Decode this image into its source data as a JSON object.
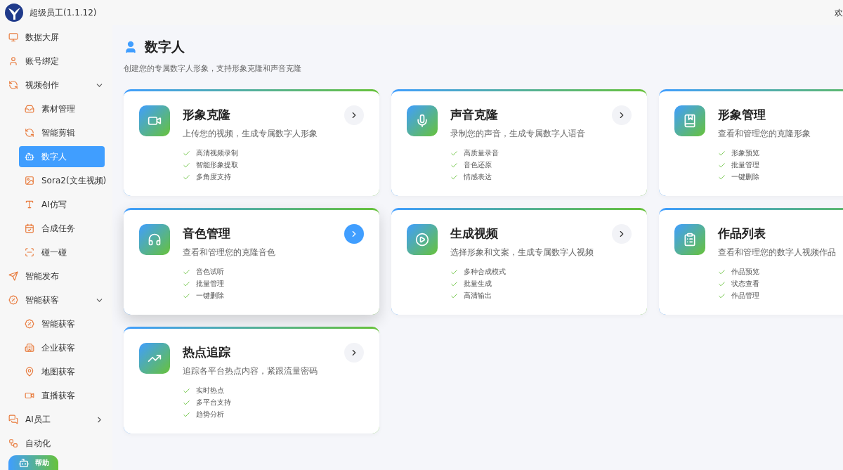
{
  "app": {
    "title": "超级员工(1.1.12)",
    "greeting": "欢"
  },
  "sidebar": {
    "items": [
      {
        "label": "数据大屏",
        "selected": false
      },
      {
        "label": "账号绑定",
        "selected": false
      },
      {
        "label": "视频创作",
        "selected": false,
        "expanded": true,
        "children": [
          {
            "label": "素材管理",
            "selected": false
          },
          {
            "label": "智能剪辑",
            "selected": false
          },
          {
            "label": "数字人",
            "selected": true
          },
          {
            "label": "Sora2(文生视频)",
            "selected": false
          },
          {
            "label": "AI仿写",
            "selected": false
          },
          {
            "label": "合成任务",
            "selected": false
          },
          {
            "label": "碰一碰",
            "selected": false
          }
        ]
      },
      {
        "label": "智能发布",
        "selected": false
      },
      {
        "label": "智能获客",
        "selected": false,
        "expanded": true,
        "children": [
          {
            "label": "智能获客",
            "selected": false
          },
          {
            "label": "企业获客",
            "selected": false
          },
          {
            "label": "地图获客",
            "selected": false
          },
          {
            "label": "直播获客",
            "selected": false
          }
        ]
      },
      {
        "label": "AI员工",
        "selected": false,
        "expanded": false
      },
      {
        "label": "自动化",
        "selected": false
      }
    ]
  },
  "help_button": {
    "label": "帮助"
  },
  "page": {
    "title": "数字人",
    "subtitle": "创建您的专属数字人形象，支持形象克隆和声音克隆"
  },
  "cards": [
    {
      "title": "形象克隆",
      "description": "上传您的视频，生成专属数字人形象",
      "features": [
        "高清视频录制",
        "智能形象提取",
        "多角度支持"
      ],
      "highlighted": false
    },
    {
      "title": "声音克隆",
      "description": "录制您的声音，生成专属数字人语音",
      "features": [
        "高质量录音",
        "音色还原",
        "情感表达"
      ],
      "highlighted": false
    },
    {
      "title": "形象管理",
      "description": "查看和管理您的克隆形象",
      "features": [
        "形象预览",
        "批量管理",
        "一键删除"
      ],
      "highlighted": false
    },
    {
      "title": "音色管理",
      "description": "查看和管理您的克隆音色",
      "features": [
        "音色试听",
        "批量管理",
        "一键删除"
      ],
      "highlighted": true
    },
    {
      "title": "生成视频",
      "description": "选择形象和文案，生成专属数字人视频",
      "features": [
        "多种合成模式",
        "批量生成",
        "高清输出"
      ],
      "highlighted": false
    },
    {
      "title": "作品列表",
      "description": "查看和管理您的数字人视频作品",
      "features": [
        "作品预览",
        "状态查看",
        "作品管理"
      ],
      "highlighted": false
    },
    {
      "title": "热点追踪",
      "description": "追踪各平台热点内容，紧跟流量密码",
      "features": [
        "实时热点",
        "多平台支持",
        "趋势分析"
      ],
      "highlighted": false
    }
  ]
}
